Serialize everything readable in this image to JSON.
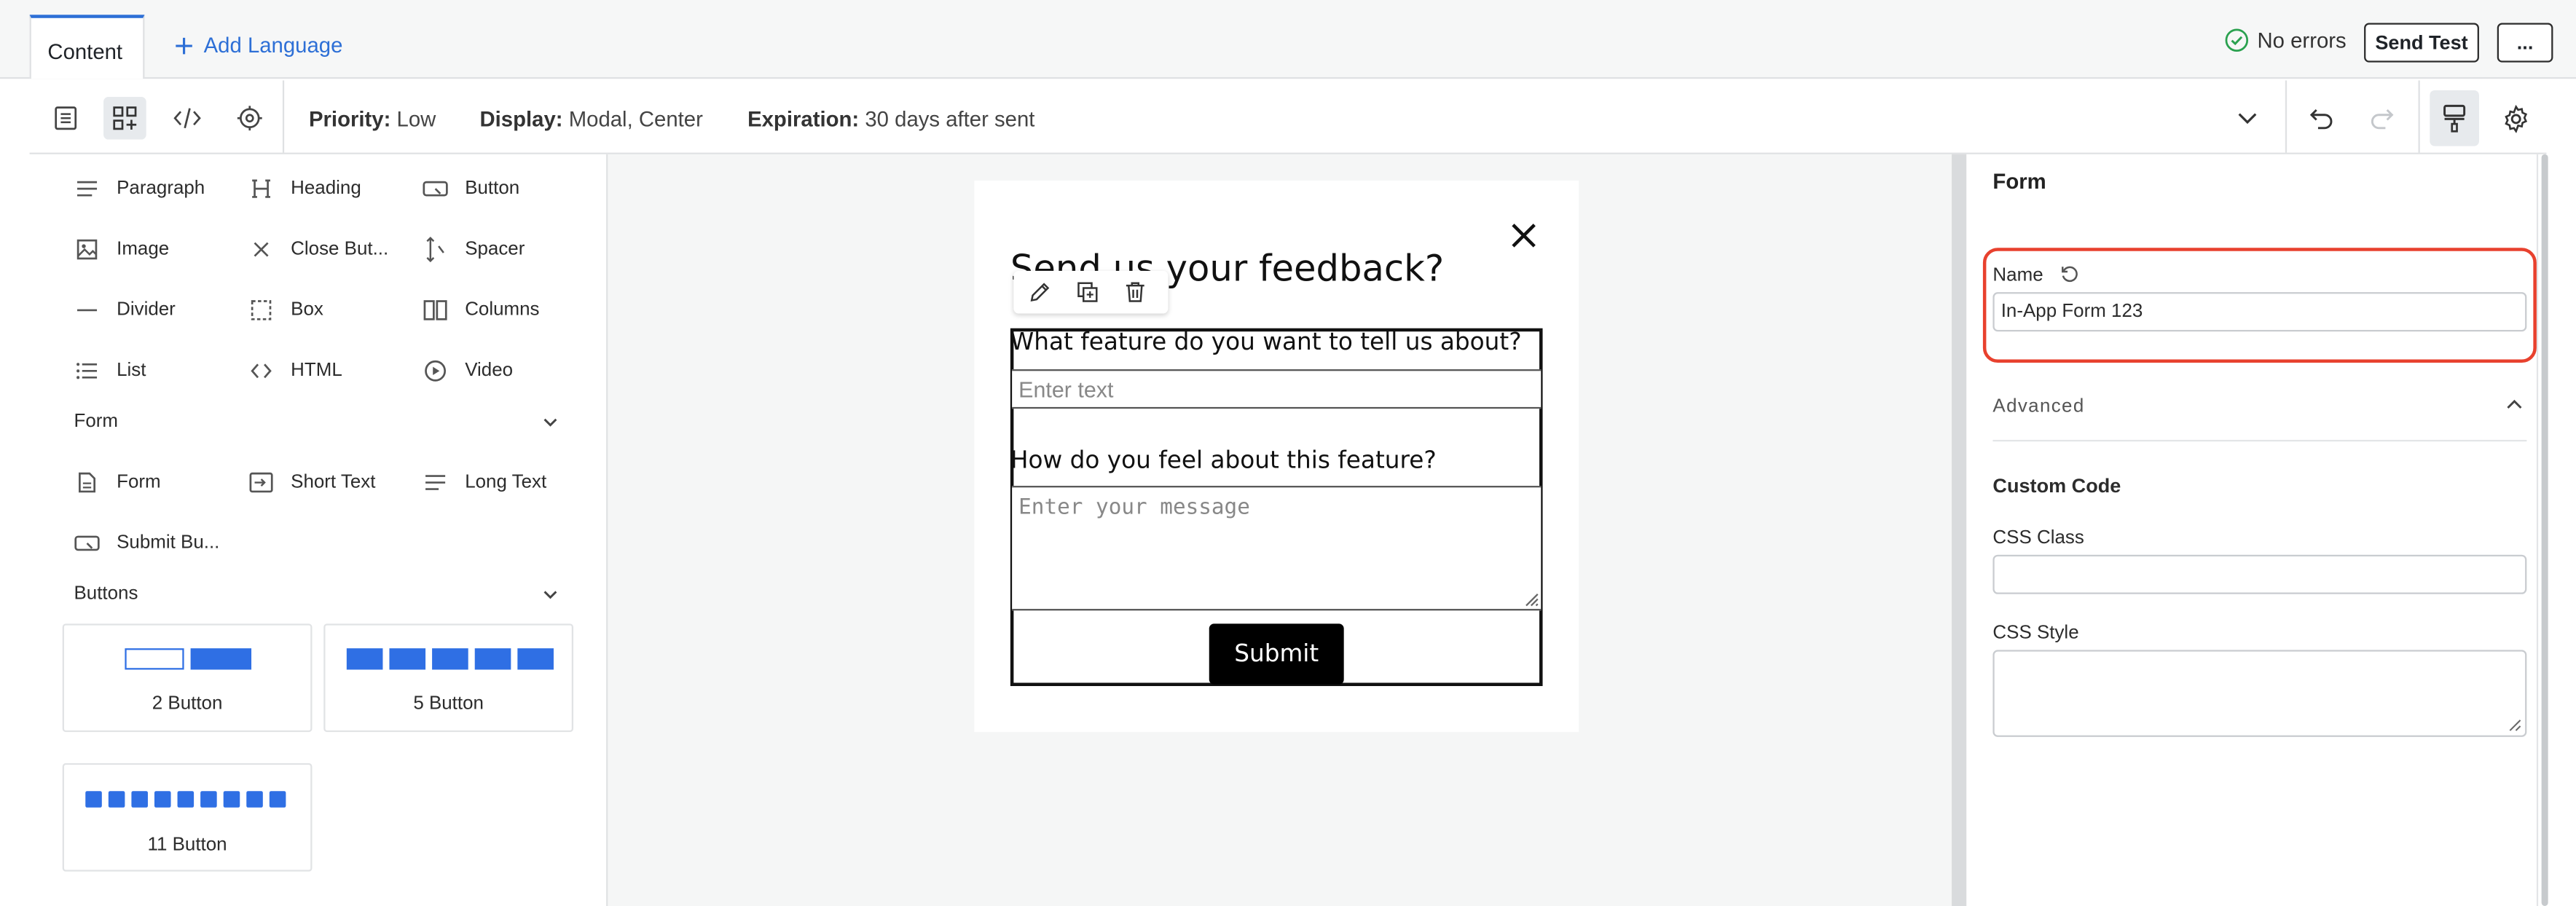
{
  "topbar": {
    "tab_content": "Content",
    "add_language": "Add Language",
    "status": "No errors",
    "send_test": "Send Test",
    "more": "..."
  },
  "toolbar": {
    "priority_label": "Priority:",
    "priority_value": "Low",
    "display_label": "Display:",
    "display_value": "Modal, Center",
    "expiration_label": "Expiration:",
    "expiration_value": "30 days after sent"
  },
  "blocks": {
    "basic": [
      {
        "label": "Paragraph",
        "icon": "paragraph-icon"
      },
      {
        "label": "Heading",
        "icon": "heading-icon"
      },
      {
        "label": "Button",
        "icon": "button-icon"
      },
      {
        "label": "Image",
        "icon": "image-icon"
      },
      {
        "label": "Close But...",
        "icon": "close-icon"
      },
      {
        "label": "Spacer",
        "icon": "spacer-icon"
      },
      {
        "label": "Divider",
        "icon": "divider-icon"
      },
      {
        "label": "Box",
        "icon": "box-icon"
      },
      {
        "label": "Columns",
        "icon": "columns-icon"
      },
      {
        "label": "List",
        "icon": "list-icon"
      },
      {
        "label": "HTML",
        "icon": "code-icon"
      },
      {
        "label": "Video",
        "icon": "video-icon"
      }
    ],
    "form_section": "Form",
    "form": [
      {
        "label": "Form",
        "icon": "form-icon"
      },
      {
        "label": "Short Text",
        "icon": "short-text-icon"
      },
      {
        "label": "Long Text",
        "icon": "long-text-icon"
      },
      {
        "label": "Submit Bu...",
        "icon": "submit-button-icon"
      }
    ],
    "buttons_section": "Buttons",
    "button_cards": [
      "2 Button",
      "5 Button",
      "11 Button"
    ]
  },
  "canvas": {
    "modal_title": "Send us your feedback?",
    "question1": "What feature do you want to tell us about?",
    "input_placeholder": "Enter text",
    "question2": "How do you feel about this feature?",
    "textarea_placeholder": "Enter your message",
    "submit_label": "Submit"
  },
  "right_panel": {
    "title": "Form",
    "name_label": "Name",
    "name_value": "In-App Form 123",
    "advanced_label": "Advanced",
    "custom_code_label": "Custom Code",
    "css_class_label": "CSS Class",
    "css_class_value": "",
    "css_style_label": "CSS Style",
    "css_style_value": ""
  },
  "colors": {
    "accent": "#2d6fd6",
    "button_blue": "#2f6fe4",
    "highlight_red": "#e8412e",
    "success_green": "#2aa14f"
  }
}
